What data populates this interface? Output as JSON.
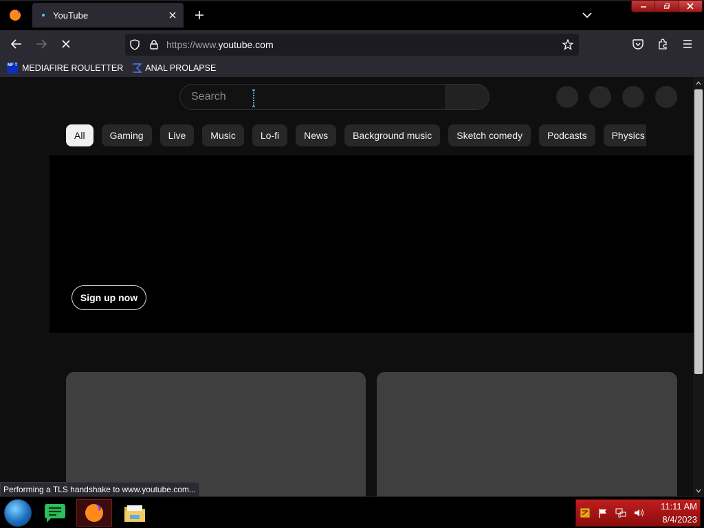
{
  "browser": {
    "tab_title": "YouTube",
    "url_prefix": "https://www.",
    "url_domain": "youtube.com",
    "bookmarks": [
      {
        "label": "MEDIAFIRE ROULETTER",
        "icon": "mediafire-icon",
        "icon_text": "MF T"
      },
      {
        "label": "ANAL PROLAPSE",
        "icon": "sigma-icon"
      }
    ],
    "status_text": "Performing a TLS handshake to www.youtube.com..."
  },
  "page": {
    "search_placeholder": "Search",
    "chips": [
      "All",
      "Gaming",
      "Live",
      "Music",
      "Lo-fi",
      "News",
      "Background music",
      "Sketch comedy",
      "Podcasts",
      "Physics"
    ],
    "active_chip": "All",
    "signup_label": "Sign up now"
  },
  "taskbar": {
    "time": "11:11 AM",
    "date": "8/4/2023"
  },
  "colors": {
    "background": "#0f0f0f",
    "chip": "#272727",
    "chip_active": "#f1f1f1",
    "tray": "#c01e1e"
  }
}
